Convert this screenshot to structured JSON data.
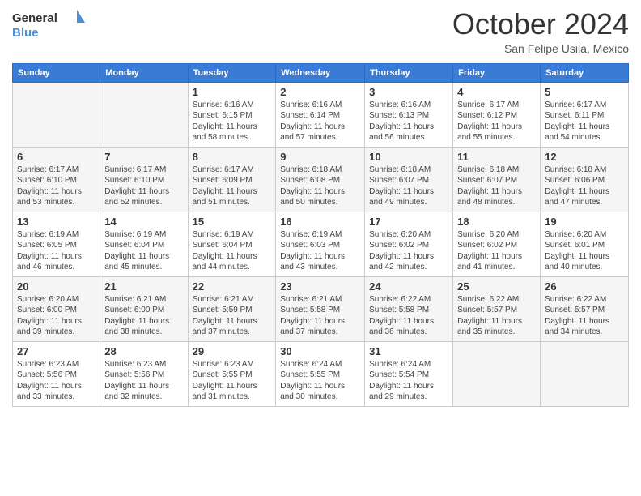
{
  "header": {
    "logo_line1": "General",
    "logo_line2": "Blue",
    "month_title": "October 2024",
    "location": "San Felipe Usila, Mexico"
  },
  "weekdays": [
    "Sunday",
    "Monday",
    "Tuesday",
    "Wednesday",
    "Thursday",
    "Friday",
    "Saturday"
  ],
  "weeks": [
    [
      null,
      null,
      {
        "day": 1,
        "sunrise": "6:16 AM",
        "sunset": "6:15 PM",
        "daylight": "11 hours and 58 minutes."
      },
      {
        "day": 2,
        "sunrise": "6:16 AM",
        "sunset": "6:14 PM",
        "daylight": "11 hours and 57 minutes."
      },
      {
        "day": 3,
        "sunrise": "6:16 AM",
        "sunset": "6:13 PM",
        "daylight": "11 hours and 56 minutes."
      },
      {
        "day": 4,
        "sunrise": "6:17 AM",
        "sunset": "6:12 PM",
        "daylight": "11 hours and 55 minutes."
      },
      {
        "day": 5,
        "sunrise": "6:17 AM",
        "sunset": "6:11 PM",
        "daylight": "11 hours and 54 minutes."
      }
    ],
    [
      {
        "day": 6,
        "sunrise": "6:17 AM",
        "sunset": "6:10 PM",
        "daylight": "11 hours and 53 minutes."
      },
      {
        "day": 7,
        "sunrise": "6:17 AM",
        "sunset": "6:10 PM",
        "daylight": "11 hours and 52 minutes."
      },
      {
        "day": 8,
        "sunrise": "6:17 AM",
        "sunset": "6:09 PM",
        "daylight": "11 hours and 51 minutes."
      },
      {
        "day": 9,
        "sunrise": "6:18 AM",
        "sunset": "6:08 PM",
        "daylight": "11 hours and 50 minutes."
      },
      {
        "day": 10,
        "sunrise": "6:18 AM",
        "sunset": "6:07 PM",
        "daylight": "11 hours and 49 minutes."
      },
      {
        "day": 11,
        "sunrise": "6:18 AM",
        "sunset": "6:07 PM",
        "daylight": "11 hours and 48 minutes."
      },
      {
        "day": 12,
        "sunrise": "6:18 AM",
        "sunset": "6:06 PM",
        "daylight": "11 hours and 47 minutes."
      }
    ],
    [
      {
        "day": 13,
        "sunrise": "6:19 AM",
        "sunset": "6:05 PM",
        "daylight": "11 hours and 46 minutes."
      },
      {
        "day": 14,
        "sunrise": "6:19 AM",
        "sunset": "6:04 PM",
        "daylight": "11 hours and 45 minutes."
      },
      {
        "day": 15,
        "sunrise": "6:19 AM",
        "sunset": "6:04 PM",
        "daylight": "11 hours and 44 minutes."
      },
      {
        "day": 16,
        "sunrise": "6:19 AM",
        "sunset": "6:03 PM",
        "daylight": "11 hours and 43 minutes."
      },
      {
        "day": 17,
        "sunrise": "6:20 AM",
        "sunset": "6:02 PM",
        "daylight": "11 hours and 42 minutes."
      },
      {
        "day": 18,
        "sunrise": "6:20 AM",
        "sunset": "6:02 PM",
        "daylight": "11 hours and 41 minutes."
      },
      {
        "day": 19,
        "sunrise": "6:20 AM",
        "sunset": "6:01 PM",
        "daylight": "11 hours and 40 minutes."
      }
    ],
    [
      {
        "day": 20,
        "sunrise": "6:20 AM",
        "sunset": "6:00 PM",
        "daylight": "11 hours and 39 minutes."
      },
      {
        "day": 21,
        "sunrise": "6:21 AM",
        "sunset": "6:00 PM",
        "daylight": "11 hours and 38 minutes."
      },
      {
        "day": 22,
        "sunrise": "6:21 AM",
        "sunset": "5:59 PM",
        "daylight": "11 hours and 37 minutes."
      },
      {
        "day": 23,
        "sunrise": "6:21 AM",
        "sunset": "5:58 PM",
        "daylight": "11 hours and 37 minutes."
      },
      {
        "day": 24,
        "sunrise": "6:22 AM",
        "sunset": "5:58 PM",
        "daylight": "11 hours and 36 minutes."
      },
      {
        "day": 25,
        "sunrise": "6:22 AM",
        "sunset": "5:57 PM",
        "daylight": "11 hours and 35 minutes."
      },
      {
        "day": 26,
        "sunrise": "6:22 AM",
        "sunset": "5:57 PM",
        "daylight": "11 hours and 34 minutes."
      }
    ],
    [
      {
        "day": 27,
        "sunrise": "6:23 AM",
        "sunset": "5:56 PM",
        "daylight": "11 hours and 33 minutes."
      },
      {
        "day": 28,
        "sunrise": "6:23 AM",
        "sunset": "5:56 PM",
        "daylight": "11 hours and 32 minutes."
      },
      {
        "day": 29,
        "sunrise": "6:23 AM",
        "sunset": "5:55 PM",
        "daylight": "11 hours and 31 minutes."
      },
      {
        "day": 30,
        "sunrise": "6:24 AM",
        "sunset": "5:55 PM",
        "daylight": "11 hours and 30 minutes."
      },
      {
        "day": 31,
        "sunrise": "6:24 AM",
        "sunset": "5:54 PM",
        "daylight": "11 hours and 29 minutes."
      },
      null,
      null
    ]
  ],
  "labels": {
    "sunrise": "Sunrise:",
    "sunset": "Sunset:",
    "daylight": "Daylight:"
  }
}
